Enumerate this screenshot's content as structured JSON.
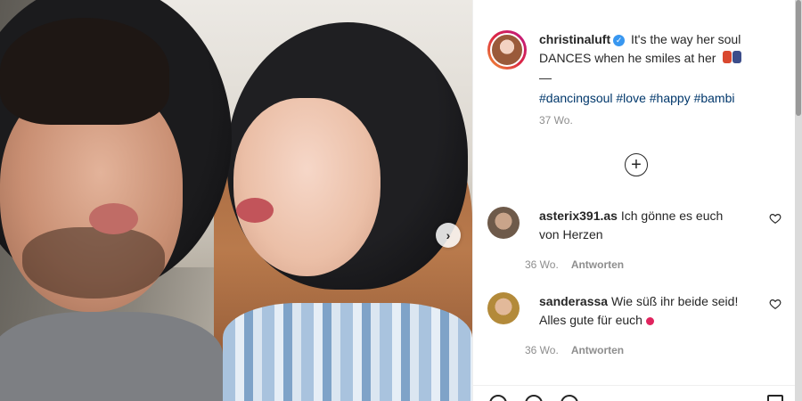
{
  "post": {
    "image_alt": "selfie photo",
    "next_icon": "chevron-right-icon"
  },
  "caption": {
    "username": "christinaluft",
    "verified_icon": "verified-badge-icon",
    "text_line1": "It's the way her soul",
    "text_line2": "DANCES when he smiles at her",
    "dash": "—",
    "hashtags": "#dancingsoul #love #happy #bambi",
    "time": "37 Wo."
  },
  "load_more_icon": "plus-circle-icon",
  "comments": [
    {
      "username": "asterix391.as",
      "text": "Ich gönne es euch von Herzen",
      "time": "36 Wo.",
      "reply_label": "Antworten",
      "heart_icon": "heart-outline-icon"
    },
    {
      "username": "sanderassa",
      "text": "Wie süß ihr beide seid! Alles gute für euch",
      "time": "36 Wo.",
      "reply_label": "Antworten",
      "heart_icon": "heart-outline-icon"
    }
  ],
  "colors": {
    "link": "#00376b",
    "muted": "#8e8e8e",
    "verified": "#3897f0"
  }
}
